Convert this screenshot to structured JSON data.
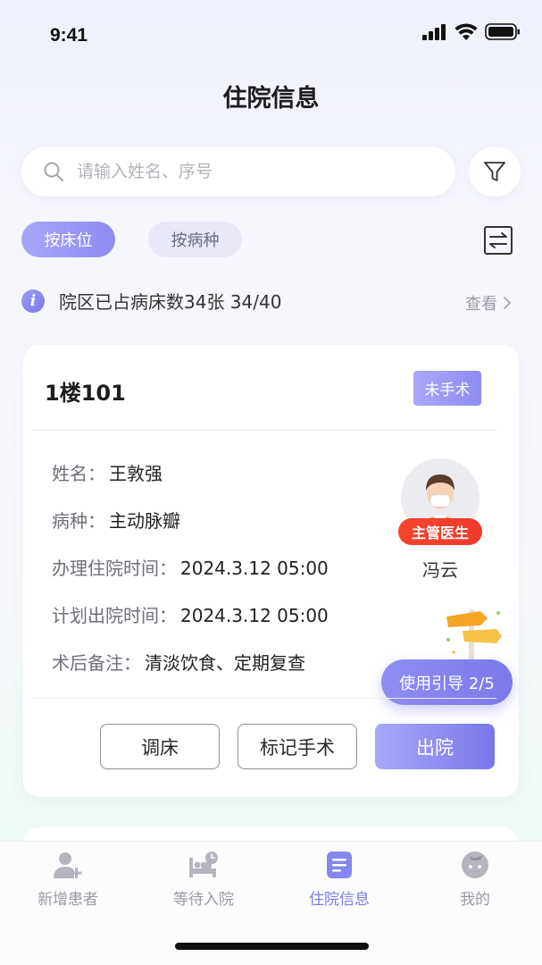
{
  "status_bar": {
    "time": "9:41"
  },
  "header": {
    "title": "住院信息"
  },
  "search": {
    "placeholder": "请输入姓名、序号",
    "value": ""
  },
  "chips": {
    "active": "按床位",
    "inactive": "按病种"
  },
  "info": {
    "text": "院区已占病床数34张 34/40",
    "view": "查看"
  },
  "card": {
    "title": "1楼101",
    "tag": "未手术",
    "fields": [
      {
        "label": "姓名：",
        "value": "王敦强"
      },
      {
        "label": "病种：",
        "value": "主动脉瓣"
      },
      {
        "label": "办理住院时间：",
        "value": "2024.3.12 05:00"
      },
      {
        "label": "计划出院时间：",
        "value": "2024.3.12 05:00"
      },
      {
        "label": "术后备注：",
        "value": "清淡饮食、定期复查"
      }
    ],
    "doctor_badge": "主管医生",
    "doctor_name": "冯云",
    "guide": "使用引导 2/5",
    "buttons": {
      "adjust": "调床",
      "mark": "标记手术",
      "discharge": "出院"
    }
  },
  "tabbar": {
    "tabs": [
      {
        "label": "新增患者",
        "icon": "add-patient-icon"
      },
      {
        "label": "等待入院",
        "icon": "bed-clock-icon"
      },
      {
        "label": "住院信息",
        "icon": "document-icon"
      },
      {
        "label": "我的",
        "icon": "profile-icon"
      }
    ],
    "active_index": 2
  },
  "colors": {
    "accent": "#7b7aea",
    "badge_red": "#f0402c",
    "inactive_text": "#9a9aa4"
  }
}
